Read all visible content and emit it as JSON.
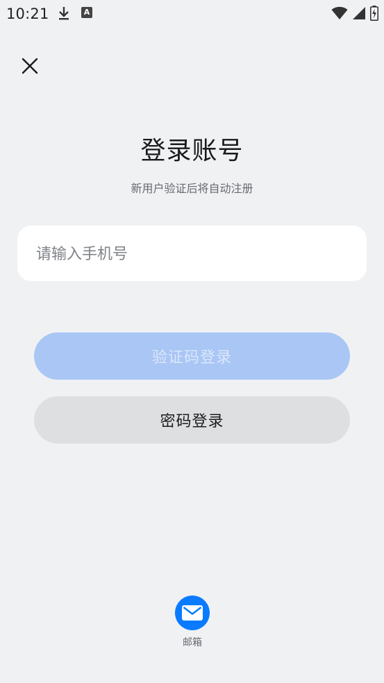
{
  "status_bar": {
    "time": "10:21",
    "download_icon": "download-icon",
    "a_badge": "A",
    "wifi_icon": "wifi-icon",
    "signal_icon": "signal-icon",
    "battery_icon": "battery-charging-icon"
  },
  "header": {
    "close_icon": "close-icon",
    "title": "登录账号",
    "subtitle": "新用户验证后将自动注册"
  },
  "form": {
    "phone_placeholder": "请输入手机号",
    "phone_value": ""
  },
  "buttons": {
    "code_login": "验证码登录",
    "password_login": "密码登录"
  },
  "alt_login": {
    "email_icon": "mail-icon",
    "email_label": "邮箱"
  },
  "colors": {
    "background": "#f0f1f3",
    "primary_disabled": "#a9c6f5",
    "secondary_button": "#dedfe1",
    "email_blue": "#0a7bff"
  }
}
